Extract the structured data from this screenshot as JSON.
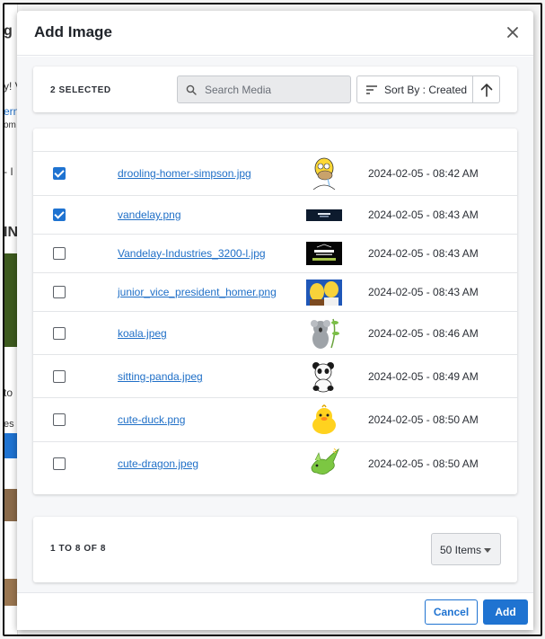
{
  "background": {
    "fragments": [
      "g",
      "y! V",
      "ern",
      "om",
      "- I",
      "IN",
      "to",
      "es"
    ]
  },
  "modal": {
    "title": "Add Image",
    "close_icon": "close-icon"
  },
  "toolbar": {
    "selected_count": "2 SELECTED",
    "search_placeholder": "Search Media",
    "search_value": "",
    "sort_label": "Sort By : Created",
    "sort_direction_icon": "arrow-up-icon"
  },
  "media": {
    "rows": [
      {
        "checked": true,
        "filename": "drooling-homer-simpson.jpg",
        "thumbnail": "homer",
        "date": "2024-02-05 - 08:42 AM"
      },
      {
        "checked": true,
        "filename": "vandelay.png",
        "thumbnail": "vandelay-banner",
        "date": "2024-02-05 - 08:43 AM"
      },
      {
        "checked": false,
        "filename": "Vandelay-Industries_3200-l.jpg",
        "thumbnail": "vandelay-logo",
        "date": "2024-02-05 - 08:43 AM"
      },
      {
        "checked": false,
        "filename": "junior_vice_president_homer.png",
        "thumbnail": "homer-vp",
        "date": "2024-02-05 - 08:43 AM"
      },
      {
        "checked": false,
        "filename": "koala.jpeg",
        "thumbnail": "koala",
        "date": "2024-02-05 - 08:46 AM"
      },
      {
        "checked": false,
        "filename": "sitting-panda.jpeg",
        "thumbnail": "panda",
        "date": "2024-02-05 - 08:49 AM"
      },
      {
        "checked": false,
        "filename": "cute-duck.png",
        "thumbnail": "duck",
        "date": "2024-02-05 - 08:50 AM"
      },
      {
        "checked": false,
        "filename": "cute-dragon.jpeg",
        "thumbnail": "dragon",
        "date": "2024-02-05 - 08:50 AM"
      }
    ]
  },
  "pagination": {
    "range": "1 TO 8 OF 8",
    "page_size_label": "50 Items"
  },
  "footer": {
    "cancel_label": "Cancel",
    "add_label": "Add"
  },
  "colors": {
    "accent": "#1f73d1",
    "link": "#1f6fc7"
  }
}
